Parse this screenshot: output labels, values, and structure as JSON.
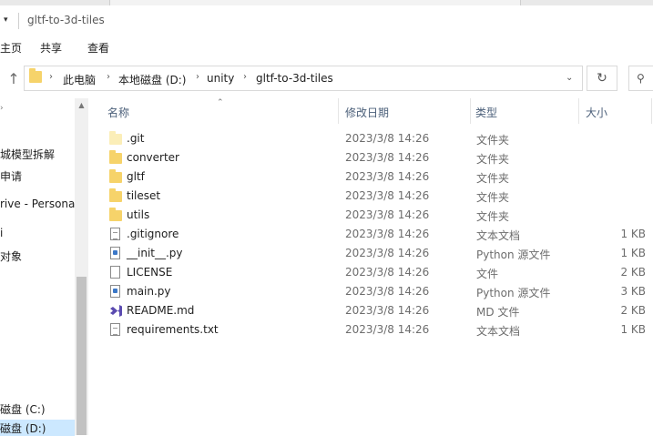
{
  "window": {
    "title": "gltf-to-3d-tiles"
  },
  "ribbon": {
    "tabs": [
      "主页",
      "共享",
      "查看"
    ]
  },
  "address": {
    "crumbs": [
      "此电脑",
      "本地磁盘 (D:)",
      "unity",
      "gltf-to-3d-tiles"
    ],
    "chevron": "›"
  },
  "sidebar": {
    "items": [
      {
        "label": "城模型拆解"
      },
      {
        "label": "申请"
      },
      {
        "label": "rive - Persona"
      },
      {
        "label": "i"
      },
      {
        "label": "对象"
      },
      {
        "label": "磁盘 (C:)"
      },
      {
        "label": "磁盘 (D:)"
      }
    ]
  },
  "columns": {
    "name": "名称",
    "modified": "修改日期",
    "type": "类型",
    "size": "大小"
  },
  "files": [
    {
      "name": ".git",
      "modified": "2023/3/8 14:26",
      "type": "文件夹",
      "size": "",
      "icon": "folder-light"
    },
    {
      "name": "converter",
      "modified": "2023/3/8 14:26",
      "type": "文件夹",
      "size": "",
      "icon": "folder"
    },
    {
      "name": "gltf",
      "modified": "2023/3/8 14:26",
      "type": "文件夹",
      "size": "",
      "icon": "folder"
    },
    {
      "name": "tileset",
      "modified": "2023/3/8 14:26",
      "type": "文件夹",
      "size": "",
      "icon": "folder"
    },
    {
      "name": "utils",
      "modified": "2023/3/8 14:26",
      "type": "文件夹",
      "size": "",
      "icon": "folder"
    },
    {
      "name": ".gitignore",
      "modified": "2023/3/8 14:26",
      "type": "文本文档",
      "size": "1 KB",
      "icon": "text-doc"
    },
    {
      "name": "__init__.py",
      "modified": "2023/3/8 14:26",
      "type": "Python 源文件",
      "size": "1 KB",
      "icon": "python-file"
    },
    {
      "name": "LICENSE",
      "modified": "2023/3/8 14:26",
      "type": "文件",
      "size": "2 KB",
      "icon": "blank-doc"
    },
    {
      "name": "main.py",
      "modified": "2023/3/8 14:26",
      "type": "Python 源文件",
      "size": "3 KB",
      "icon": "python-file"
    },
    {
      "name": "README.md",
      "modified": "2023/3/8 14:26",
      "type": "MD 文件",
      "size": "2 KB",
      "icon": "vscode"
    },
    {
      "name": "requirements.txt",
      "modified": "2023/3/8 14:26",
      "type": "文本文档",
      "size": "1 KB",
      "icon": "text-doc"
    }
  ]
}
